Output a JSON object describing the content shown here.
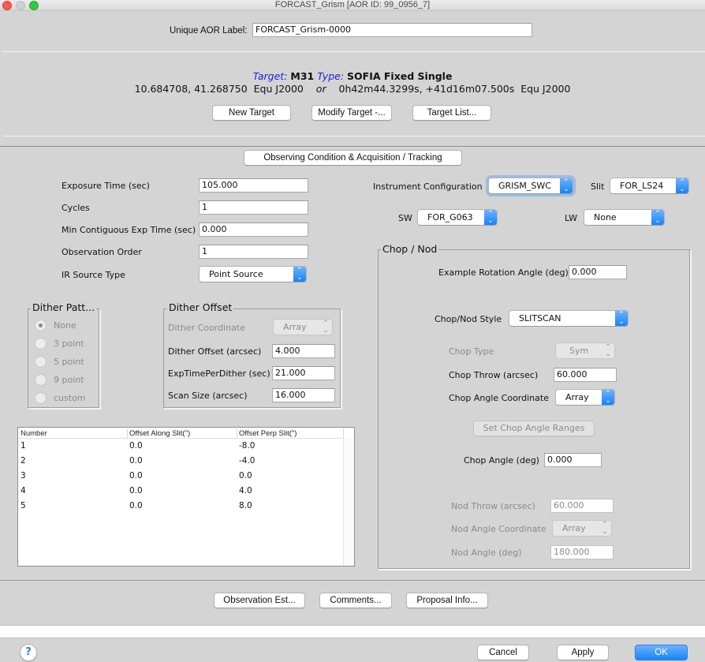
{
  "window": {
    "title": "FORCAST_Grism [AOR ID: 99_0956_7]"
  },
  "aor_label": {
    "label": "Unique AOR Label:",
    "value": "FORCAST_Grism-0000"
  },
  "target": {
    "target_prefix": "Target:",
    "target_name": "M31",
    "type_prefix": "Type:",
    "type_name": "SOFIA Fixed Single",
    "coords_decimal": "10.684708, 41.268750  Equ J2000",
    "or": "or",
    "coords_sexagesimal": "0h42m44.3299s, +41d16m07.500s  Equ J2000",
    "buttons": {
      "new_target": "New Target",
      "modify_target": "Modify Target -...",
      "target_list": "Target List..."
    }
  },
  "observing_condition_button": "Observing Condition & Acquisition / Tracking",
  "params": {
    "exposure_time": {
      "label": "Exposure Time (sec)",
      "value": "105.000"
    },
    "cycles": {
      "label": "Cycles",
      "value": "1"
    },
    "min_contig": {
      "label": "Min Contiguous Exp Time (sec)",
      "value": "0.000"
    },
    "obs_order": {
      "label": "Observation Order",
      "value": "1"
    },
    "ir_source_type": {
      "label": "IR Source Type",
      "value": "Point Source"
    }
  },
  "instrument": {
    "config_label": "Instrument Configuration",
    "config_value": "GRISM_SWC",
    "slit_label": "Slit",
    "slit_value": "FOR_LS24",
    "sw_label": "SW",
    "sw_value": "FOR_G063",
    "lw_label": "LW",
    "lw_value": "None"
  },
  "dither_pattern": {
    "title": "Dither Patt...",
    "options": [
      "None",
      "3 point",
      "5 point",
      "9 point",
      "custom"
    ],
    "selected": "None"
  },
  "dither_offset": {
    "title": "Dither Offset",
    "coordinate_label": "Dither Coordinate",
    "coordinate_value": "Array",
    "offset_label": "Dither Offset (arcsec)",
    "offset_value": "4.000",
    "exp_per_dither_label": "ExpTimePerDither (sec)",
    "exp_per_dither_value": "21.000",
    "scan_size_label": "Scan Size (arcsec)",
    "scan_size_value": "16.000"
  },
  "offset_table": {
    "columns": [
      "Number",
      "Offset Along Slit(\")",
      "Offset Perp Slit(\")"
    ],
    "rows": [
      [
        "1",
        "0.0",
        "-8.0"
      ],
      [
        "2",
        "0.0",
        "-4.0"
      ],
      [
        "3",
        "0.0",
        "0.0"
      ],
      [
        "4",
        "0.0",
        "4.0"
      ],
      [
        "5",
        "0.0",
        "8.0"
      ]
    ]
  },
  "chop_nod": {
    "title": "Chop / Nod",
    "rotation_label": "Example Rotation Angle (deg)",
    "rotation_value": "0.000",
    "style_label": "Chop/Nod Style",
    "style_value": "SLITSCAN",
    "chop_type_label": "Chop Type",
    "chop_type_value": "Sym",
    "chop_throw_label": "Chop Throw (arcsec)",
    "chop_throw_value": "60.000",
    "chop_angle_coord_label": "Chop Angle Coordinate",
    "chop_angle_coord_value": "Array",
    "set_ranges_button": "Set Chop Angle Ranges",
    "chop_angle_label": "Chop Angle (deg)",
    "chop_angle_value": "0.000",
    "nod_throw_label": "Nod Throw (arcsec)",
    "nod_throw_value": "60.000",
    "nod_angle_coord_label": "Nod Angle Coordinate",
    "nod_angle_coord_value": "Array",
    "nod_angle_label": "Nod Angle (deg)",
    "nod_angle_value": "180.000"
  },
  "bottom_buttons": {
    "observation_est": "Observation Est...",
    "comments": "Comments...",
    "proposal_info": "Proposal Info..."
  },
  "footer": {
    "help": "?",
    "cancel": "Cancel",
    "apply": "Apply",
    "ok": "OK"
  },
  "colors": {
    "accent_blue": "#1a82fb",
    "label_blue": "#1d1de0",
    "background": "#d4d4d4"
  },
  "icons": {
    "select_arrow": "updown-chevron-icon",
    "help": "question-mark-icon"
  }
}
